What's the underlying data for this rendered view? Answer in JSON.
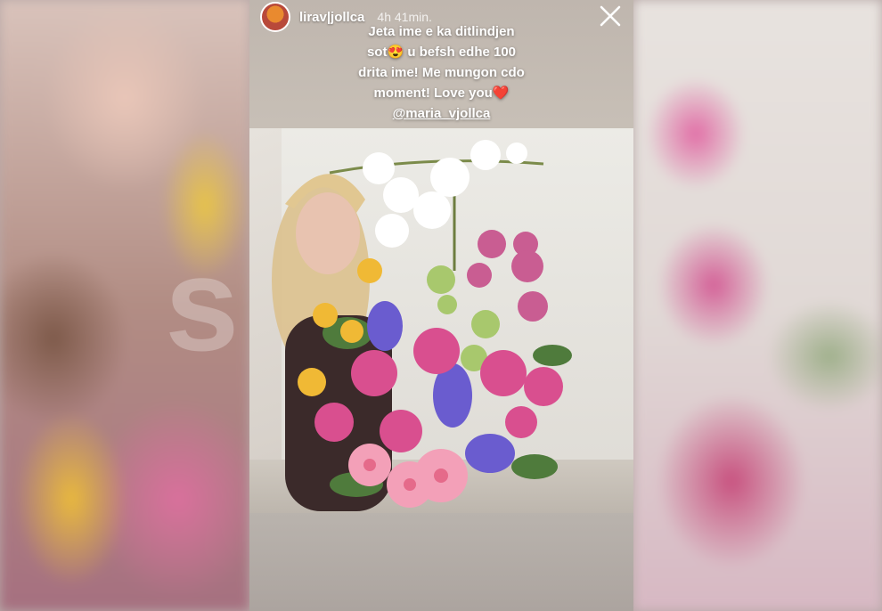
{
  "story": {
    "username": "lirav|jollca",
    "timestamp": "4h 41min.",
    "caption_lines": [
      "Jeta ime e ka ditlindjen",
      "sot😍 u befsh edhe 100",
      "drita ime! Me mungon cdo",
      "moment! Love you❤️"
    ],
    "mention": "@maria_vjollca"
  },
  "watermark": "sot.al",
  "icons": {
    "close": "close-icon",
    "avatar": "avatar"
  },
  "colors": {
    "flowers_pink": "#d94f8f",
    "flowers_purple": "#6a5ccf",
    "orchid_white": "#ffffff"
  }
}
